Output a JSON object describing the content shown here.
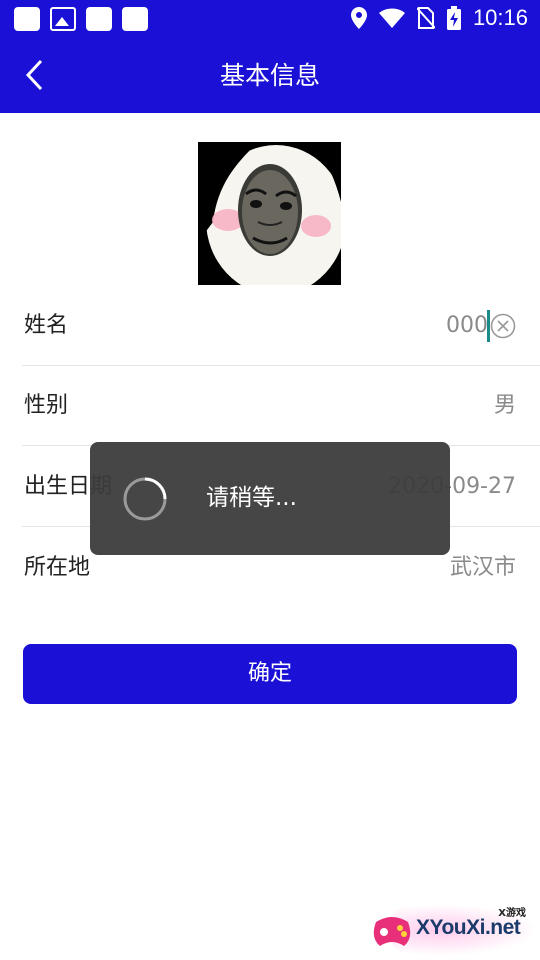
{
  "status_bar": {
    "time": "10:16",
    "left_icons": [
      "notification-icon",
      "image-icon",
      "notification-icon",
      "notification-icon"
    ],
    "right_icons": [
      "location-icon",
      "wifi-icon",
      "no-sim-icon",
      "battery-charging-icon"
    ]
  },
  "appbar": {
    "title": "基本信息",
    "back_icon": "chevron-left-icon"
  },
  "form": {
    "name": {
      "label": "姓名",
      "value": "000"
    },
    "gender": {
      "label": "性别",
      "value": "男"
    },
    "birth_date": {
      "label": "出生日期",
      "value": "2020-09-27"
    },
    "location": {
      "label": "所在地",
      "value": "武汉市"
    }
  },
  "confirm_button": {
    "label": "确定"
  },
  "loading_toast": {
    "text": "请稍等..."
  },
  "watermark": {
    "text": "XYouXi.net",
    "sub": "X游戏"
  },
  "colors": {
    "primary": "#1a10d6",
    "toast_bg": "#3c3c3c",
    "value_text": "#8a8a8a"
  }
}
